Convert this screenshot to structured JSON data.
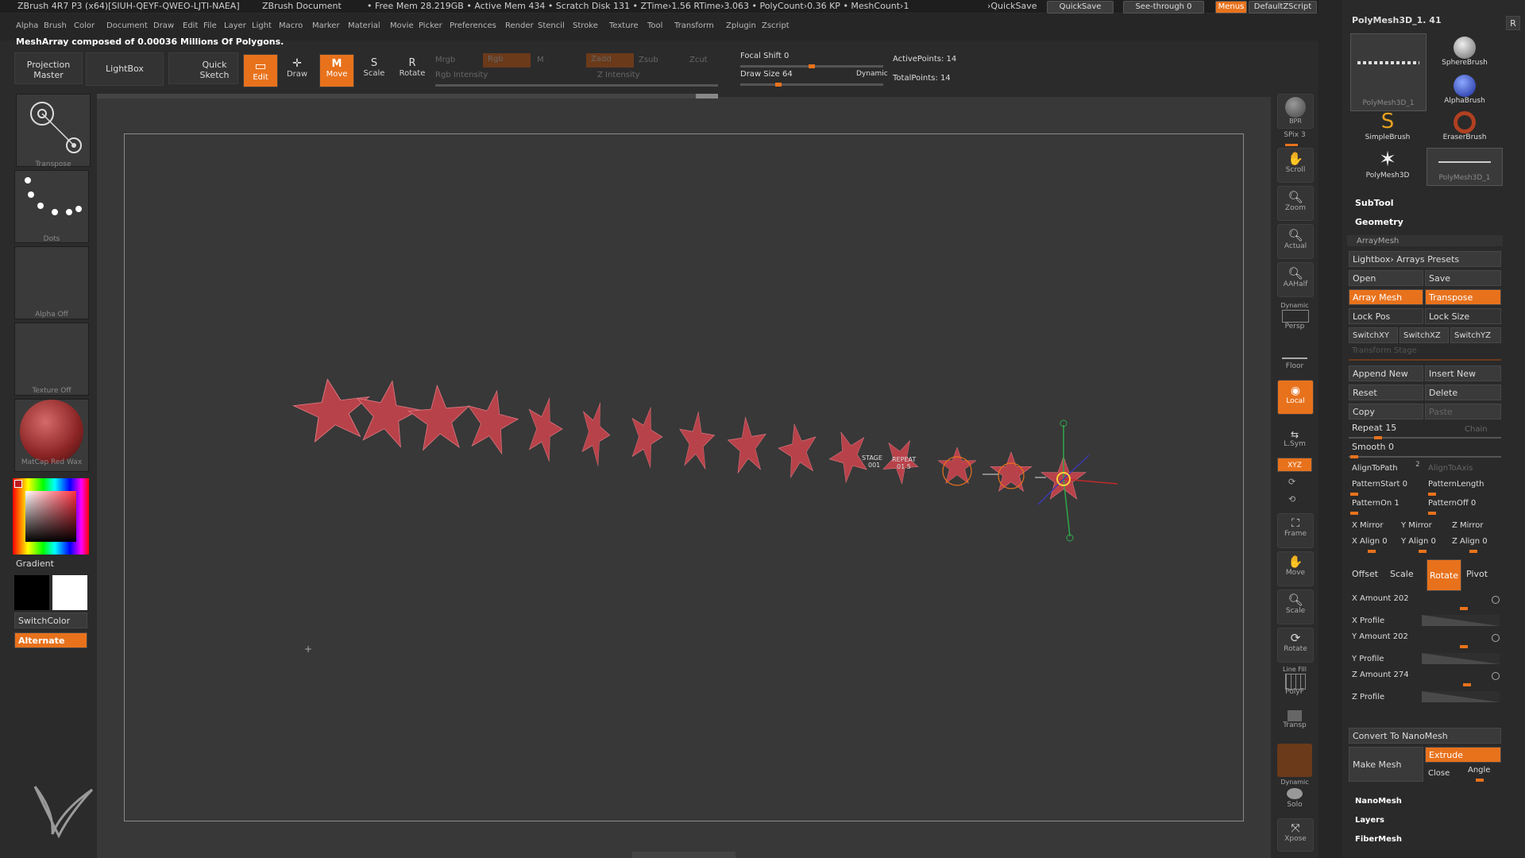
{
  "title_bar": {
    "app": "ZBrush 4R7 P3 (x64)[SIUH-QEYF-QWEO-LJTI-NAEA]",
    "document": "ZBrush Document",
    "stats": "• Free Mem 28.219GB • Active Mem 434 • Scratch Disk 131 • ZTime›1.56 RTime›3.063 • PolyCount›0.36 KP • MeshCount›1",
    "quicksave_link": "›QuickSave",
    "quicksave": "QuickSave",
    "see_through": "See-through  0",
    "menus": "Menus",
    "default_script": "DefaultZScript"
  },
  "menu_items": [
    "Alpha",
    "Brush",
    "Color",
    "Document",
    "Draw",
    "Edit",
    "File",
    "Layer",
    "Light",
    "Macro",
    "Marker",
    "Material",
    "Movie",
    "Picker",
    "Preferences",
    "Render",
    "Stencil",
    "Stroke",
    "Texture",
    "Tool",
    "Transform",
    "Zplugin",
    "Zscript"
  ],
  "status": "MeshArray composed of 0.00036 Millions Of Polygons.",
  "toolbar": {
    "projection_master": "Projection Master",
    "lightbox": "LightBox",
    "quick_sketch": "Quick Sketch",
    "edit": "Edit",
    "draw": "Draw",
    "move": "Move",
    "scale": "Scale",
    "rotate": "Rotate",
    "mrgb": "Mrgb",
    "rgb": "Rgb",
    "m": "M",
    "zadd": "Zadd",
    "zsub": "Zsub",
    "zcut": "Zcut",
    "rgb_intensity": "Rgb Intensity",
    "z_intensity": "Z Intensity",
    "focal_shift": "Focal Shift 0",
    "draw_size": "Draw Size 64",
    "dynamic": "Dynamic",
    "active_points": "ActivePoints: 14",
    "total_points": "TotalPoints: 14"
  },
  "left_panel": {
    "transpose": "Transpose",
    "dots": "Dots",
    "alpha_off": "Alpha Off",
    "texture_off": "Texture Off",
    "matcap": "MatCap Red Wax",
    "gradient": "Gradient",
    "switch_color": "SwitchColor",
    "alternate": "Alternate"
  },
  "canvas_labels": {
    "stage": "STAGE",
    "stage_val": "001",
    "repeat": "REPEAT",
    "repeat_val": "01 5"
  },
  "right_shelf": {
    "bpr": "BPR",
    "spix": "SPix 3",
    "scroll": "Scroll",
    "zoom": "Zoom",
    "actual": "Actual",
    "aahalf": "AAHalf",
    "dynamic": "Dynamic",
    "persp": "Persp",
    "floor": "Floor",
    "local": "Local",
    "lsym": "L.Sym",
    "xyz": "XYZ",
    "frame": "Frame",
    "move": "Move",
    "scale": "Scale",
    "rotate": "Rotate",
    "line_fill": "Line Fill",
    "polyf": "PolyF",
    "transp": "Transp",
    "dynamic2": "Dynamic",
    "solo": "Solo",
    "xpose": "Xpose"
  },
  "tray": {
    "tool_name": "PolyMesh3D_1. 41",
    "r": "R",
    "brushes": [
      "SphereBrush",
      "AlphaBrush",
      "SimpleBrush",
      "EraserBrush",
      "PolyMesh3D",
      "PolyMesh3D_1"
    ],
    "polymesh_thumb": "PolyMesh3D_1",
    "subtool": "SubTool",
    "geometry": "Geometry",
    "arraymesh": "ArrayMesh",
    "lightbox_presets": "Lightbox› Arrays Presets",
    "open": "Open",
    "save": "Save",
    "array_mesh": "Array Mesh",
    "transpose": "Transpose",
    "lock_pos": "Lock Pos",
    "lock_size": "Lock Size",
    "switch_xy": "SwitchXY",
    "switch_xz": "SwitchXZ",
    "switch_yz": "SwitchYZ",
    "transform_stage": "Transform Stage",
    "append_new": "Append New",
    "insert_new": "Insert New",
    "reset": "Reset",
    "delete": "Delete",
    "copy": "Copy",
    "paste": "Paste",
    "repeat": "Repeat 15",
    "chain": "Chain",
    "smooth": "Smooth 0",
    "align_to_path": "AlignToPath",
    "align_to_path_n": "2",
    "align_to_axis": "AlignToAxis",
    "pattern_start": "PatternStart 0",
    "pattern_length": "PatternLength",
    "pattern_on": "PatternOn 1",
    "pattern_off": "PatternOff 0",
    "x_mirror": "X Mirror",
    "y_mirror": "Y Mirror",
    "z_mirror": "Z Mirror",
    "x_align": "X Align 0",
    "y_align": "Y Align 0",
    "z_align": "Z Align 0",
    "offset": "Offset",
    "scale": "Scale",
    "rotate": "Rotate",
    "pivot": "Pivot",
    "x_amount": "X Amount 202",
    "x_profile": "X Profile",
    "y_amount": "Y Amount 202",
    "y_profile": "Y Profile",
    "z_amount": "Z Amount 274",
    "z_profile": "Z Profile",
    "convert_nanomesh": "Convert To NanoMesh",
    "make_mesh": "Make Mesh",
    "extrude": "Extrude",
    "close": "Close",
    "angle": "Angle",
    "nanomesh": "NanoMesh",
    "layers": "Layers",
    "fibermesh": "FiberMesh"
  },
  "colors": {
    "accent": "#e8721c",
    "star": "#b8424a",
    "canvas": "#383838"
  }
}
